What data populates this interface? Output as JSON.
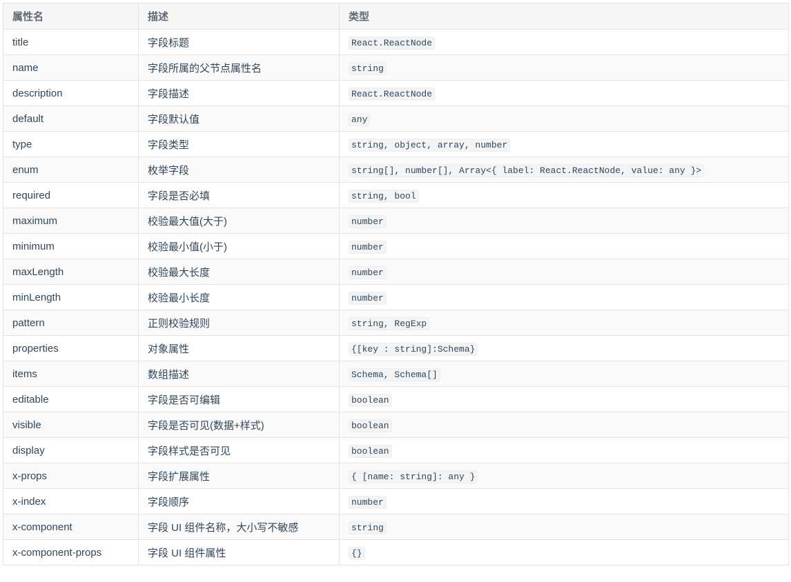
{
  "headers": [
    "属性名",
    "描述",
    "类型"
  ],
  "rows": [
    [
      "title",
      "字段标题",
      "React.ReactNode"
    ],
    [
      "name",
      "字段所属的父节点属性名",
      "string"
    ],
    [
      "description",
      "字段描述",
      "React.ReactNode"
    ],
    [
      "default",
      "字段默认值",
      "any"
    ],
    [
      "type",
      "字段类型",
      "string, object, array, number"
    ],
    [
      "enum",
      "枚举字段",
      "string[], number[], Array<{ label: React.ReactNode, value: any }>"
    ],
    [
      "required",
      "字段是否必填",
      "string, bool"
    ],
    [
      "maximum",
      "校验最大值(大于)",
      "number"
    ],
    [
      "minimum",
      "校验最小值(小于)",
      "number"
    ],
    [
      "maxLength",
      "校验最大长度",
      "number"
    ],
    [
      "minLength",
      "校验最小长度",
      "number"
    ],
    [
      "pattern",
      "正则校验规则",
      "string, RegExp"
    ],
    [
      "properties",
      "对象属性",
      "{[key : string]:Schema}"
    ],
    [
      "items",
      "数组描述",
      "Schema, Schema[]"
    ],
    [
      "editable",
      "字段是否可编辑",
      "boolean"
    ],
    [
      "visible",
      "字段是否可见(数据+样式)",
      "boolean"
    ],
    [
      "display",
      "字段样式是否可见",
      "boolean"
    ],
    [
      "x-props",
      "字段扩展属性",
      "{ [name: string]: any }"
    ],
    [
      "x-index",
      "字段顺序",
      "number"
    ],
    [
      "x-component",
      "字段 UI 组件名称，大小写不敏感",
      "string"
    ],
    [
      "x-component-props",
      "字段 UI 组件属性",
      "{}"
    ]
  ]
}
